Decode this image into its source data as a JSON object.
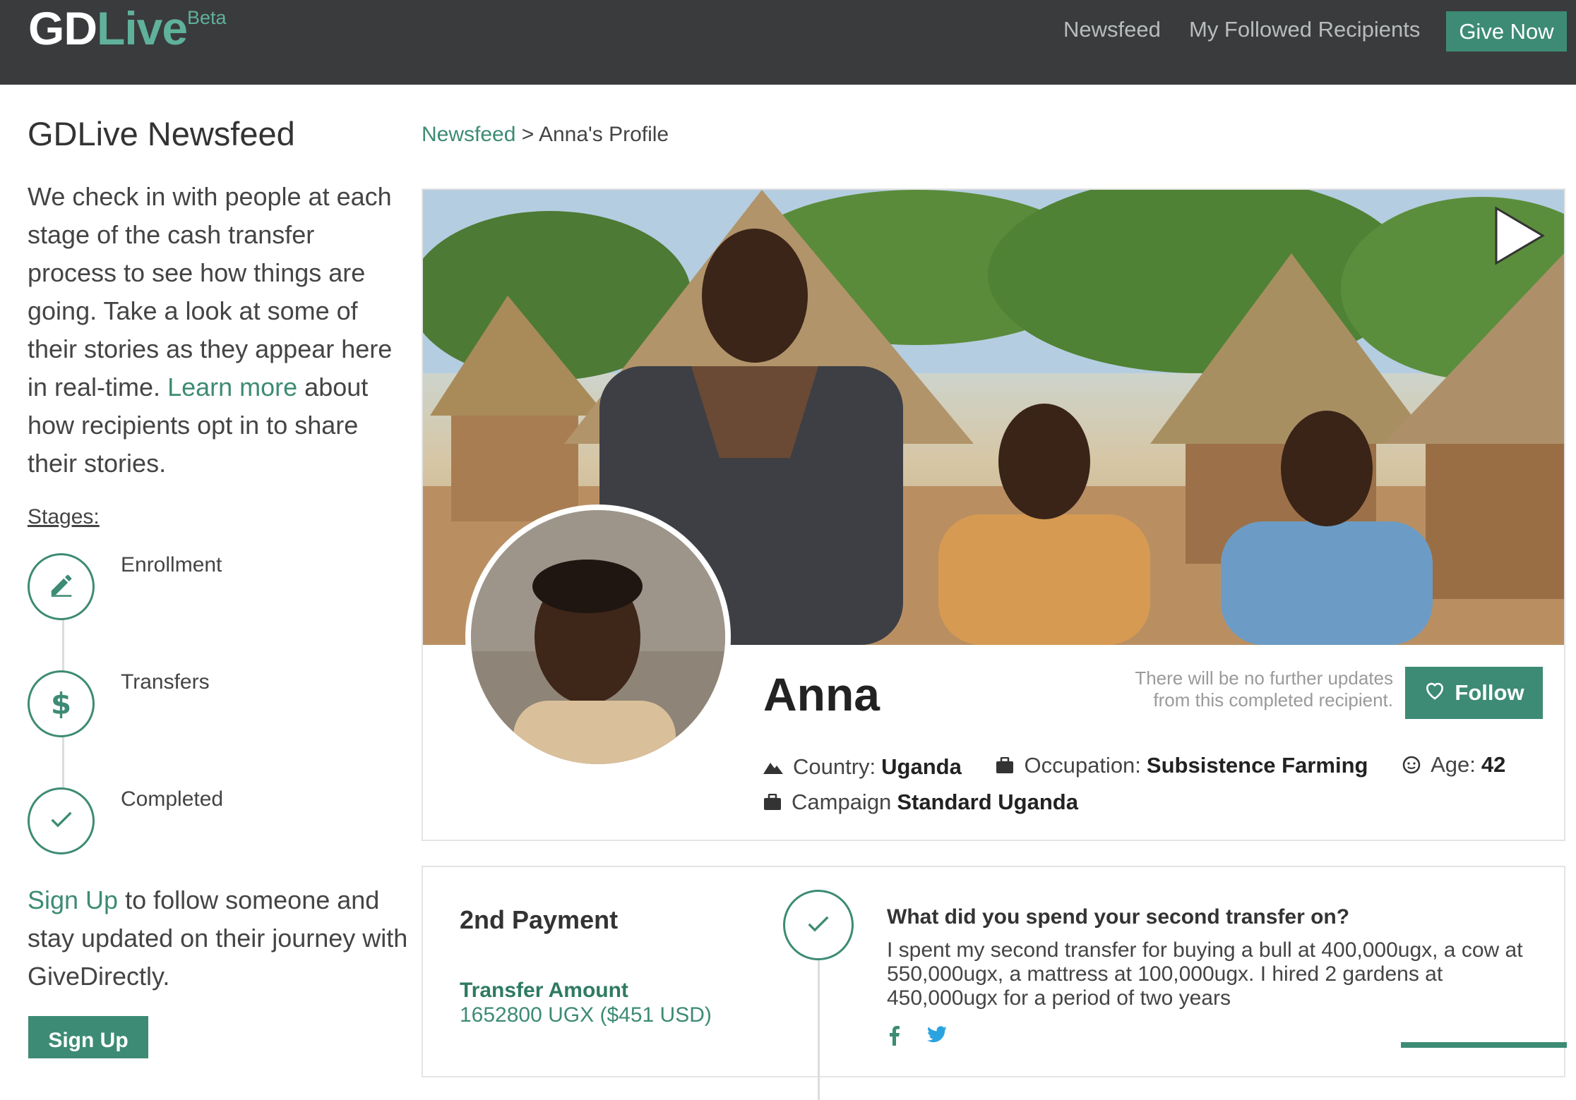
{
  "brand": {
    "name_a": "GD",
    "name_b": "Live",
    "badge": "Beta",
    "accent_color": "#3d8b74"
  },
  "nav": {
    "links": [
      "Newsfeed",
      "My Followed Recipients"
    ],
    "cta": "Give Now"
  },
  "sidebar": {
    "title": "GDLive Newsfeed",
    "intro_before": "We check in with people at each stage of the cash transfer process to see how things are going. Take a look at some of their stories as they appear here in real-time. ",
    "learn_more": "Learn more",
    "intro_after": " about how recipients opt in to share their stories.",
    "stages_label": "Stages:",
    "stages": [
      {
        "label": "Enrollment",
        "icon": "pencil-icon"
      },
      {
        "label": "Transfers",
        "icon": "dollar-icon"
      },
      {
        "label": "Completed",
        "icon": "check-icon"
      }
    ],
    "signup_link": "Sign Up",
    "signup_text": " to follow someone and stay updated on their journey with GiveDirectly.",
    "signup_button": "Sign Up"
  },
  "breadcrumb": {
    "root": "Newsfeed",
    "separator": " > ",
    "current": "Anna's Profile"
  },
  "profile": {
    "name": "Anna",
    "notice": "There will be no further updates from this completed recipient.",
    "follow_label": "Follow",
    "country_label": "Country:",
    "country": "Uganda",
    "occupation_label": "Occupation:",
    "occupation": "Subsistence Farming",
    "age_label": "Age:",
    "age": "42",
    "campaign_label": "Campaign",
    "campaign": "Standard Uganda"
  },
  "payment": {
    "title": "2nd Payment",
    "amount_label": "Transfer Amount",
    "amount": "1652800 UGX ($451 USD)",
    "question": "What did you spend your second transfer on?",
    "answer": "I spent my second transfer for buying a bull at 400,000ugx, a cow at 550,000ugx, a mattress at 100,000ugx. I hired 2 gardens at 450,000ugx for a period of two years"
  }
}
